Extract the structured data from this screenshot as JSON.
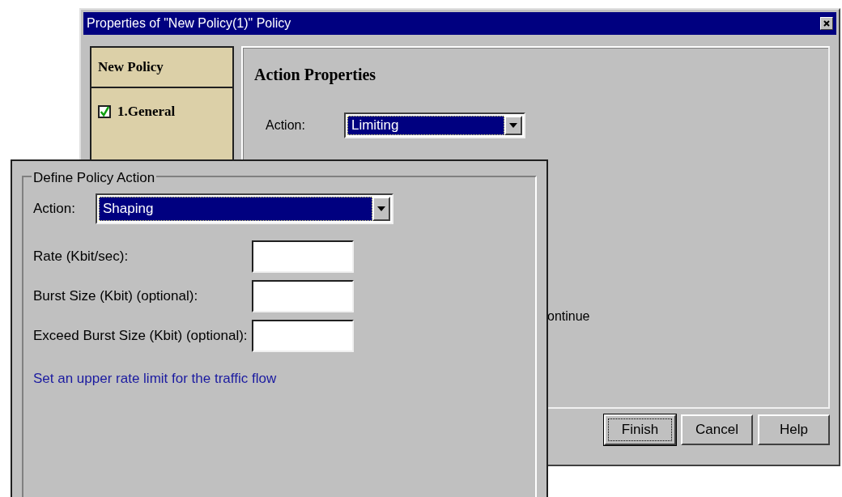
{
  "back_window": {
    "title": "Properties of \"New Policy(1)\" Policy",
    "sidebar": {
      "heading": "New Policy",
      "items": [
        {
          "label": "1.General",
          "checked": true
        }
      ]
    },
    "panel": {
      "heading": "Action Properties",
      "action_label": "Action:",
      "action_value": "Limiting",
      "partial_text": "ontinue"
    },
    "buttons": [
      {
        "label": "Finish",
        "focused": true
      },
      {
        "label": "Cancel",
        "focused": false
      },
      {
        "label": "Help",
        "focused": false
      }
    ]
  },
  "front_window": {
    "group_title": "Define Policy Action",
    "action_label": "Action:",
    "action_value": "Shaping",
    "fields": [
      {
        "label": "Rate (Kbit/sec):"
      },
      {
        "label": "Burst Size (Kbit) (optional):"
      },
      {
        "label": "Exceed Burst Size (Kbit) (optional):"
      }
    ],
    "hint": "Set an upper rate limit for the traffic flow"
  }
}
